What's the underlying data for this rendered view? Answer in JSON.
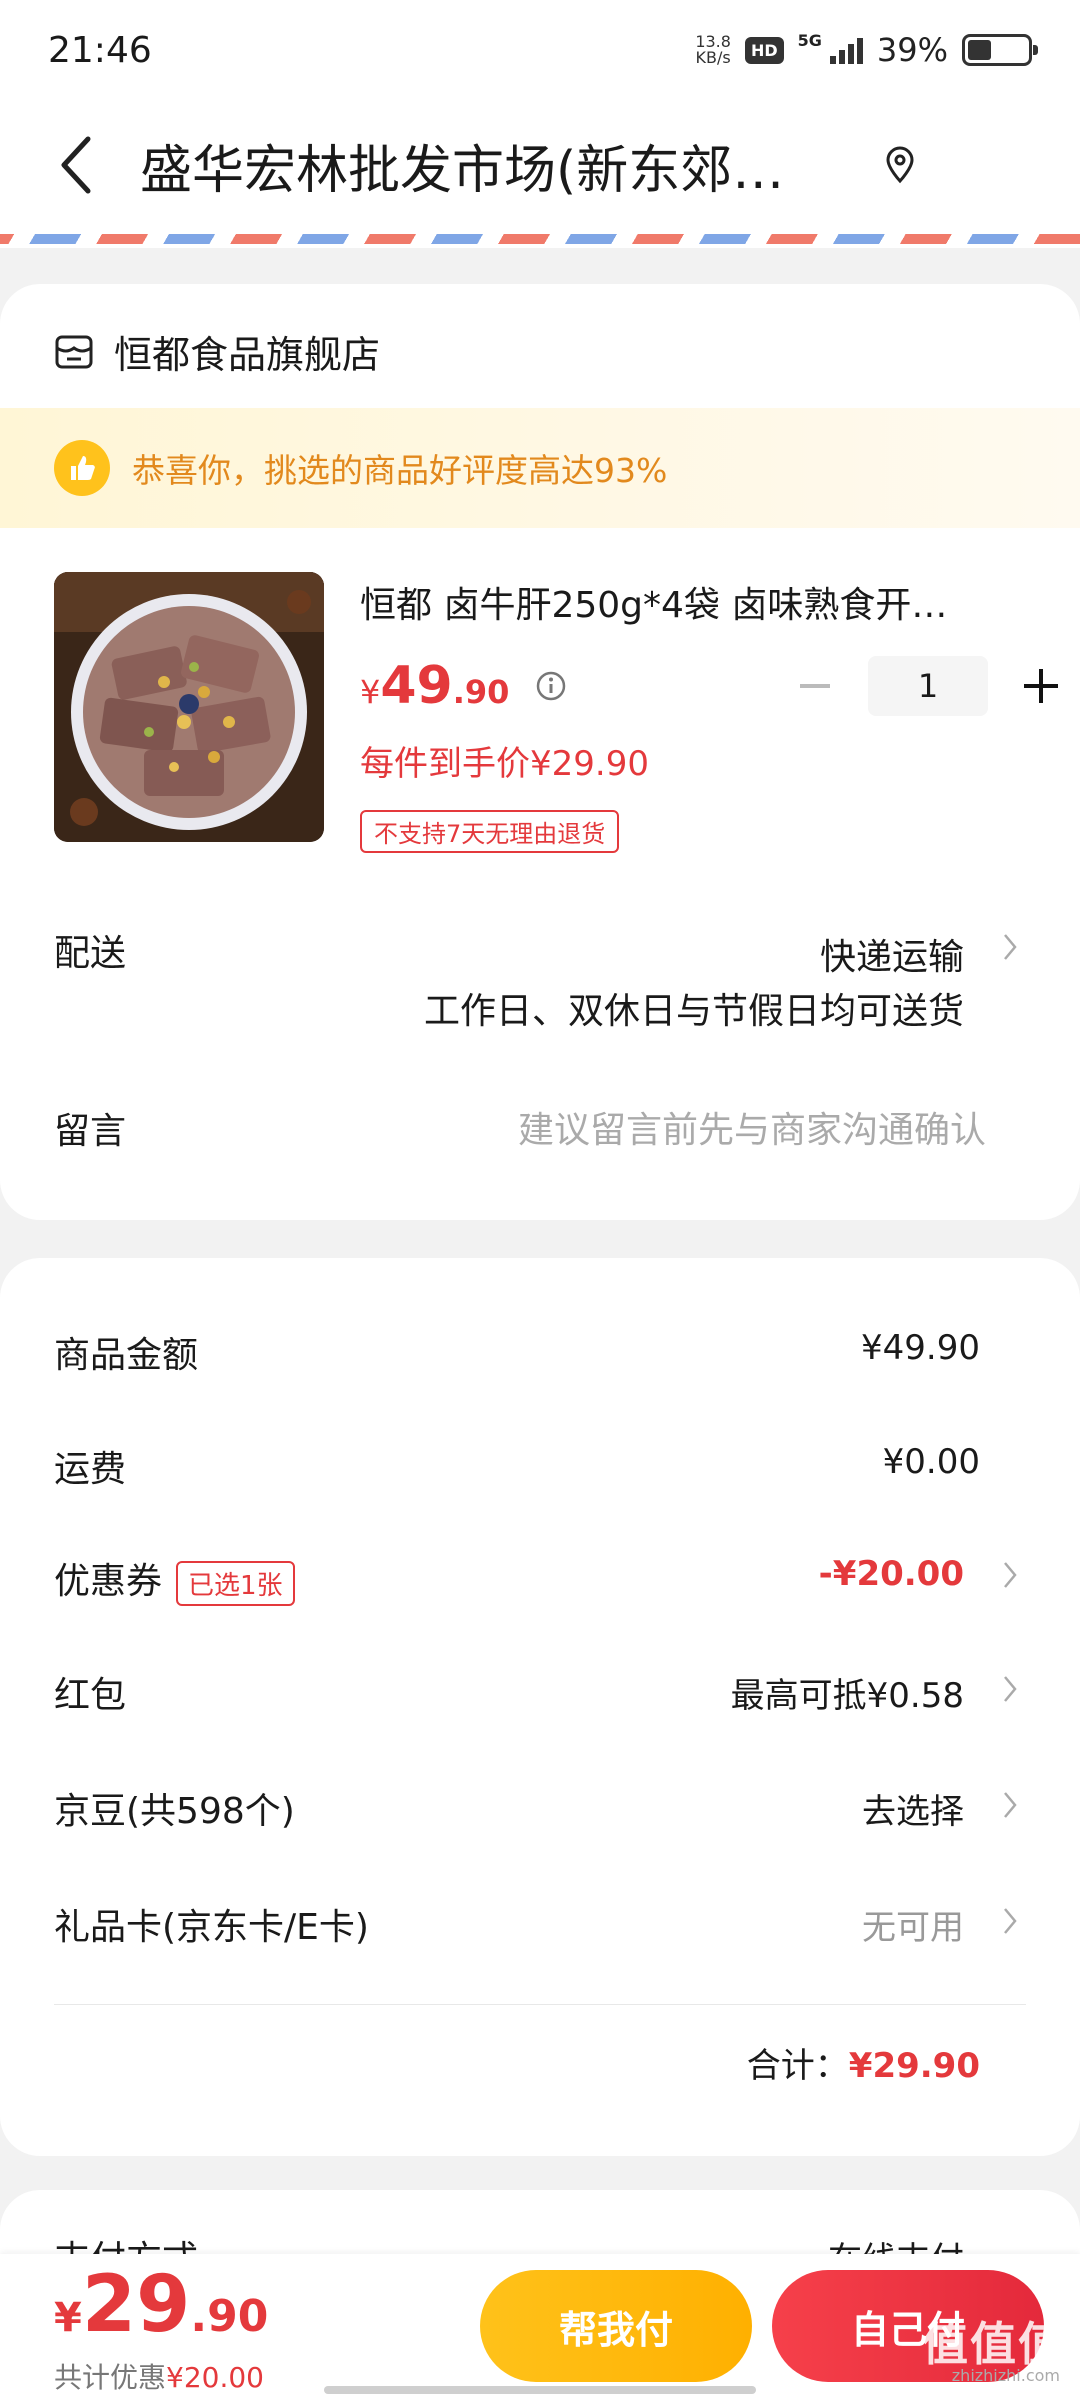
{
  "status_bar": {
    "time": "21:46",
    "net_speed_value": "13.8",
    "net_speed_unit": "KB/s",
    "hd_badge": "HD",
    "network": "5G",
    "battery_percent": "39%",
    "battery_level": 0.39
  },
  "header": {
    "title": "盛华宏林批发市场(新东郊…",
    "back_icon": "chevron-left-icon",
    "location_icon": "location-pin-icon"
  },
  "shop": {
    "name": "恒都食品旗舰店",
    "notice": "恭喜你，挑选的商品好评度高达93%"
  },
  "product": {
    "title": "恒都 卤牛肝250g*4袋 卤味熟食开…",
    "price_symbol": "¥",
    "price_int": "49",
    "price_dec": ".90",
    "quantity": "1",
    "unit_price_text": "每件到手价¥29.90",
    "return_tag": "不支持7天无理由退货"
  },
  "delivery": {
    "label": "配送",
    "value": "快递运输",
    "sub": "工作日、双休日与节假日均可送货"
  },
  "message": {
    "label": "留言",
    "placeholder": "建议留言前先与商家沟通确认"
  },
  "summary": {
    "goods_label": "商品金额",
    "goods_value": "¥49.90",
    "shipping_label": "运费",
    "shipping_value": "¥0.00",
    "coupon_label": "优惠券",
    "coupon_tag": "已选1张",
    "coupon_value": "-¥20.00",
    "redpacket_label": "红包",
    "redpacket_value": "最高可抵¥0.58",
    "jingdou_label": "京豆(共598个)",
    "jingdou_value": "去选择",
    "giftcard_label": "礼品卡(京东卡/E卡)",
    "giftcard_value": "无可用",
    "total_label": "合计：",
    "total_value": "¥29.90"
  },
  "payment": {
    "label": "支付方式",
    "value": "在线支付"
  },
  "bottom": {
    "price_symbol": "¥",
    "price_int": "29",
    "price_dec": ".90",
    "discount_prefix": "共计优惠",
    "discount_value": "¥20.00",
    "help_pay": "帮我付",
    "self_pay": "自己付",
    "watermark": "值值值",
    "watermark_sub": "zhizhizhi.com"
  },
  "colors": {
    "accent_red": "#e4393c",
    "notice_orange": "#e2891d",
    "help_yellow": "#ffc21a"
  }
}
